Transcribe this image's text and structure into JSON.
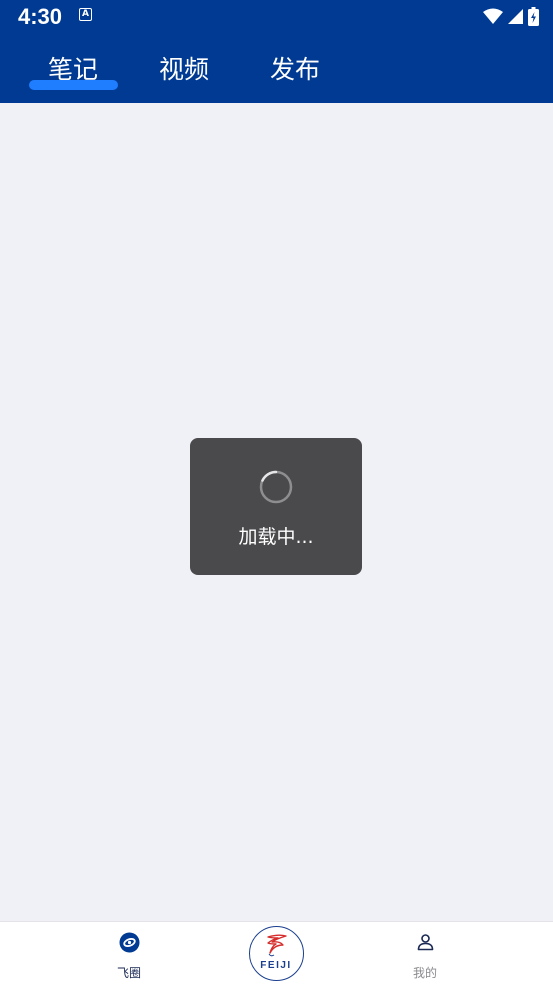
{
  "status_bar": {
    "time": "4:30",
    "notification_icon": "A",
    "icons": [
      "wifi-icon",
      "cellular-signal-icon",
      "battery-charging-icon"
    ]
  },
  "tabs": {
    "items": [
      {
        "label": "笔记",
        "active": true
      },
      {
        "label": "视频",
        "active": false
      },
      {
        "label": "发布",
        "active": false
      }
    ]
  },
  "loading": {
    "text": "加载中...",
    "icon": "spinner-icon"
  },
  "bottom_nav": {
    "items": [
      {
        "label": "飞圈",
        "icon": "feiquan-icon",
        "active": true
      },
      {
        "label": "FEIJI",
        "icon": "feiji-logo",
        "active": false
      },
      {
        "label": "我的",
        "icon": "user-icon",
        "active": false
      }
    ]
  },
  "colors": {
    "header_bg": "#003a92",
    "tab_indicator": "#1f7dff",
    "content_bg": "#f0f1f7",
    "toast_bg": "#4a4a4c",
    "logo_blue": "#1a3f8f",
    "logo_red": "#d62c2c"
  }
}
